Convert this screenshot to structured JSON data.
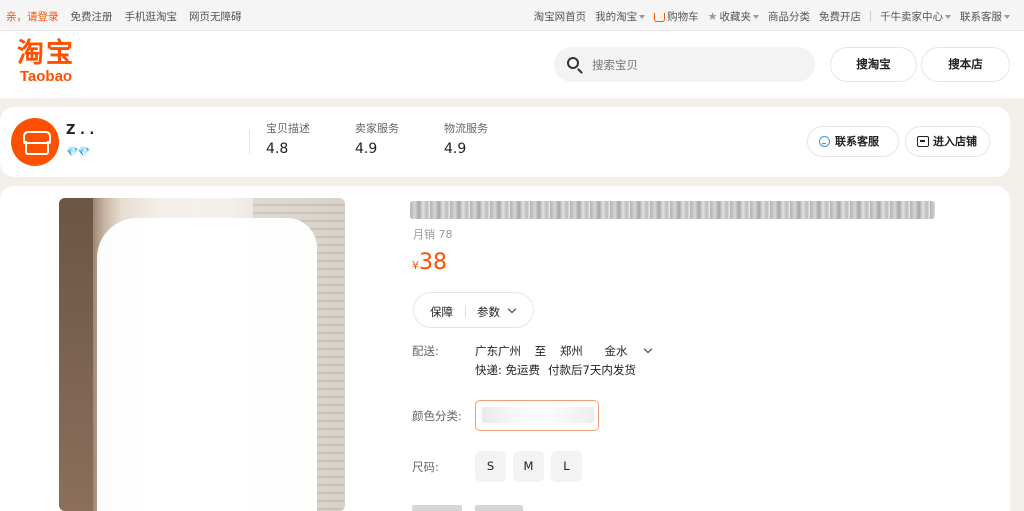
{
  "topbar": {
    "greeting": "亲，请登录",
    "register": "免费注册",
    "mobile": "手机逛淘宝",
    "accessible": "网页无障碍",
    "home": "淘宝网首页",
    "my_taobao": "我的淘宝",
    "cart": "购物车",
    "favorites": "收藏夹",
    "categories": "商品分类",
    "open_shop": "免费开店",
    "seller_center": "千牛卖家中心",
    "service": "联系客服"
  },
  "header": {
    "logo_cn": "淘宝",
    "logo_en": "Taobao",
    "search_placeholder": "搜索宝贝",
    "search_taobao": "搜淘宝",
    "search_store": "搜本店"
  },
  "shop": {
    "name": "Z . .",
    "diamonds": "💎💎",
    "metrics": [
      {
        "label": "宝贝描述",
        "value": "4.8"
      },
      {
        "label": "卖家服务",
        "value": "4.9"
      },
      {
        "label": "物流服务",
        "value": "4.9"
      }
    ],
    "contact_label": "联系客服",
    "enter_label": "进入店铺"
  },
  "product": {
    "sales": "月销 78",
    "currency": "¥",
    "price": "38",
    "tab_guarantee": "保障",
    "tab_params": "参数",
    "shipping_label": "配送:",
    "ship_from": "广东广州",
    "ship_to_word": "至",
    "ship_to": "郑州",
    "district": "金水",
    "express": "快递: 免运费",
    "dispatch": "付款后7天内发货",
    "color_label": "颜色分类:",
    "size_label": "尺码:",
    "sizes": [
      "S",
      "M",
      "L"
    ]
  },
  "colors": {
    "accent": "#ff5000",
    "background": "#f2efe9"
  }
}
